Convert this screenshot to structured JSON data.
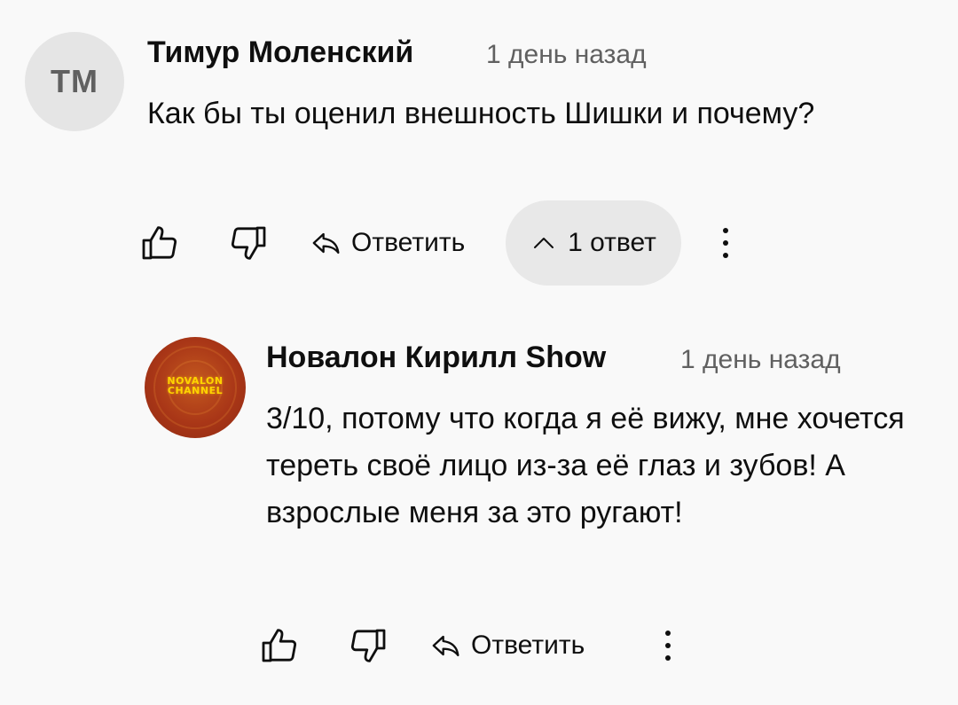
{
  "comment": {
    "avatar_initials": "ТМ",
    "author": "Тимур Моленский",
    "time": "1 день назад",
    "text": "Как бы ты оценил внешность Шишки  и почему?",
    "reply_label": "Ответить",
    "replies_label": "1 ответ"
  },
  "reply": {
    "avatar_logo_lines": [
      "NOVALON",
      "CHANNEL"
    ],
    "author": "Новалон Кирилл Show",
    "time": "1 день назад",
    "text": "3/10, потому что когда я её вижу, мне хочется тереть своё лицо из-за её глаз и зубов! А взрослые меня за это ругают!",
    "reply_label": "Ответить"
  },
  "colors": {
    "background": "#f9f9f9",
    "text": "#0f0f0f",
    "secondary_text": "#606060",
    "pill_background": "#e8e8e8",
    "logo_text": "#ffd400",
    "logo_background": "#a93617"
  }
}
